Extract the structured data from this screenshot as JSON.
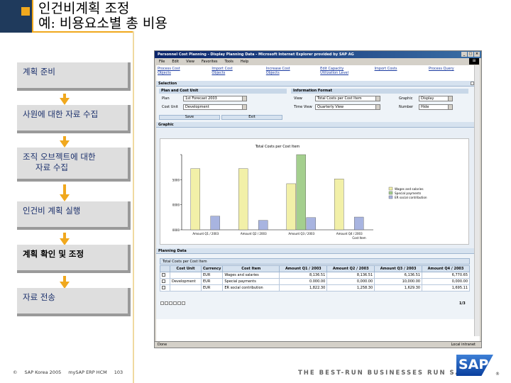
{
  "slide": {
    "title_line1": "인건비계획 조정",
    "title_line2": "예: 비용요소별 총 비용",
    "steps": [
      {
        "label": "계획 준비"
      },
      {
        "label": "사원에 대한 자료 수집"
      },
      {
        "label_line1": "조직 오브젝트에 대한",
        "label_line2": "자료 수집"
      },
      {
        "label": "인건비 계획 실행"
      },
      {
        "label": "계획 확인 및 조정"
      },
      {
        "label": "자료 전송"
      }
    ],
    "footer": {
      "copyright": "©",
      "company": "SAP Korea 2005",
      "course": "mySAP ERP HCM",
      "page": "103"
    },
    "tagline": "THE BEST-RUN BUSINESSES RUN SAP",
    "logo_text": "SAP",
    "logo_mark": "®"
  },
  "browser": {
    "title": "Personnel Cost Planning - Display Planning Data - Microsoft Internet Explorer provided by SAP AG",
    "menu": [
      "File",
      "Edit",
      "View",
      "Favorites",
      "Tools",
      "Help"
    ],
    "status_left": "Done",
    "status_right": "Local intranet",
    "links": [
      {
        "l1": "Process Cost",
        "l2": "Objects"
      },
      {
        "l1": "Import Cost",
        "l2": "Objects"
      },
      {
        "l1": "Increase Cost",
        "l2": "Objects"
      },
      {
        "l1": "Edit Capacity",
        "l2": "Utilization Level"
      },
      {
        "l1": "Import Costs",
        "l2": ""
      },
      {
        "l1": "Process Query",
        "l2": ""
      }
    ],
    "selection": {
      "header": "Selection",
      "plan_panel": "Plan and Cost Unit",
      "info_panel": "Information Format",
      "plan_label": "Plan",
      "plan_value": "1st Forecast 2003",
      "cost_unit_label": "Cost Unit",
      "cost_unit_value": "Development",
      "view_label": "View",
      "view_value": "Total Costs per Cost Item",
      "timeview_label": "Time View",
      "timeview_value": "Quarterly View",
      "graphic_label": "Graphic",
      "graphic_value": "Display",
      "number_label": "Number",
      "number_value": "Hide",
      "save_label": "Save",
      "exit_label": "Exit"
    },
    "graphic_header": "Graphic",
    "planning_header": "Planning Data",
    "table_caption": "Total Costs per Cost Item",
    "table": {
      "headers": [
        "",
        "Cost Unit",
        "Currency",
        "Cost Item",
        "Amount Q1 / 2003",
        "Amount Q2 / 2003",
        "Amount Q3 / 2003",
        "Amount Q4 / 2003"
      ],
      "rows": [
        [
          "",
          "",
          "EUR",
          "Wages and salaries",
          "8,136.51",
          "8,136.51",
          "6,136.51",
          "6,770.65"
        ],
        [
          "",
          "Development",
          "EUR",
          "Special payments",
          "0.000.00",
          "0,000.00",
          "10,000.00",
          "0,000.00"
        ],
        [
          "",
          "",
          "EUR",
          "ER social contribution",
          "1,822.30",
          "1,258.30",
          "1,629.30",
          "1,695.11"
        ]
      ],
      "page": "1/3"
    }
  },
  "chart_data": {
    "type": "bar",
    "title": "Total Costs per Cost Item",
    "categories": [
      "Amount Q1 / 2003",
      "Amount Q2 / 2003",
      "Amount Q3 / 2003",
      "Amount Q4 / 2003"
    ],
    "series": [
      {
        "name": "Wages and salaries",
        "color": "#f2f0a8",
        "values": [
          8136.51,
          8136.51,
          6136.51,
          6770.65
        ]
      },
      {
        "name": "Special payments",
        "color": "#a4cf8e",
        "values": [
          0,
          0,
          10000,
          0
        ]
      },
      {
        "name": "ER social contribution",
        "color": "#a8b4e0",
        "values": [
          1822.3,
          1258.3,
          1629.3,
          1695.11
        ]
      }
    ],
    "y_ticks": [
      "",
      "5000",
      "0000",
      "0000"
    ],
    "ylim": [
      0,
      10000
    ],
    "xlabel": "Cost Item",
    "legend": "right"
  }
}
